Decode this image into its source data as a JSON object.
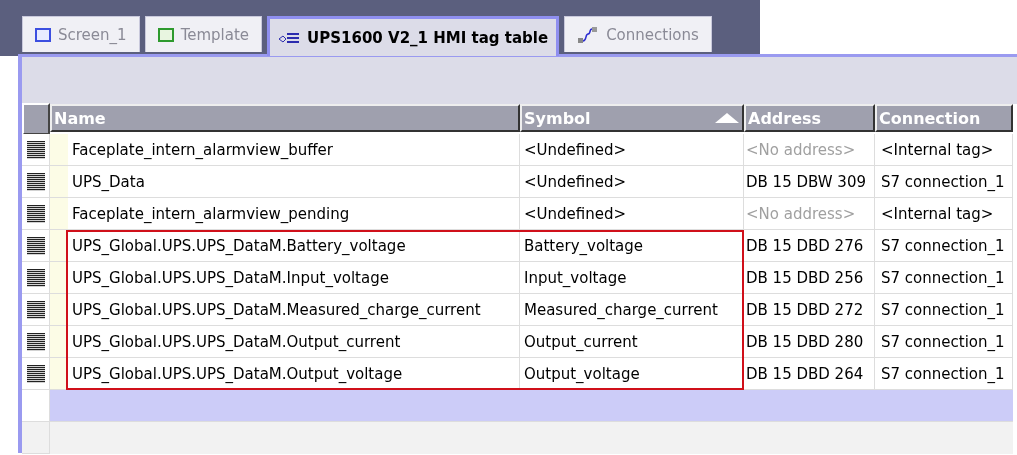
{
  "tabs": [
    {
      "label": "Screen_1",
      "kind": "screen",
      "selected": false
    },
    {
      "label": "Template",
      "kind": "template",
      "selected": false
    },
    {
      "label": "UPS1600 V2_1 HMI tag table",
      "kind": "tagtable",
      "selected": true
    },
    {
      "label": "Connections",
      "kind": "connections",
      "selected": false
    }
  ],
  "table": {
    "columns": [
      {
        "label": "Name",
        "sorted": false
      },
      {
        "label": "Symbol",
        "sorted": true
      },
      {
        "label": "Address",
        "sorted": false
      },
      {
        "label": "Connection",
        "sorted": false
      }
    ],
    "rows": [
      {
        "name": "Faceplate_intern_alarmview_buffer",
        "symbol": "<Undefined>",
        "address": "<No address>",
        "address_dimmed": true,
        "connection": "<Internal tag>",
        "highlighted": false
      },
      {
        "name": "UPS_Data",
        "symbol": "<Undefined>",
        "address": "DB 15 DBW 309",
        "address_dimmed": false,
        "connection": "S7 connection_1",
        "highlighted": false
      },
      {
        "name": "Faceplate_intern_alarmview_pending",
        "symbol": "<Undefined>",
        "address": "<No address>",
        "address_dimmed": true,
        "connection": "<Internal tag>",
        "highlighted": false
      },
      {
        "name": "UPS_Global.UPS.UPS_DataM.Battery_voltage",
        "symbol": "Battery_voltage",
        "address": "DB 15 DBD 276",
        "address_dimmed": false,
        "connection": "S7 connection_1",
        "highlighted": true
      },
      {
        "name": "UPS_Global.UPS.UPS_DataM.Input_voltage",
        "symbol": "Input_voltage",
        "address": "DB 15 DBD 256",
        "address_dimmed": false,
        "connection": "S7 connection_1",
        "highlighted": true
      },
      {
        "name": "UPS_Global.UPS.UPS_DataM.Measured_charge_current",
        "symbol": "Measured_charge_current",
        "address": "DB 15 DBD 272",
        "address_dimmed": false,
        "connection": "S7 connection_1",
        "highlighted": true
      },
      {
        "name": "UPS_Global.UPS.UPS_DataM.Output_current",
        "symbol": "Output_current",
        "address": "DB 15 DBD 280",
        "address_dimmed": false,
        "connection": "S7 connection_1",
        "highlighted": true
      },
      {
        "name": "UPS_Global.UPS.UPS_DataM.Output_voltage",
        "symbol": "Output_voltage",
        "address": "DB 15 DBD 264",
        "address_dimmed": false,
        "connection": "S7 connection_1",
        "highlighted": true
      }
    ]
  }
}
